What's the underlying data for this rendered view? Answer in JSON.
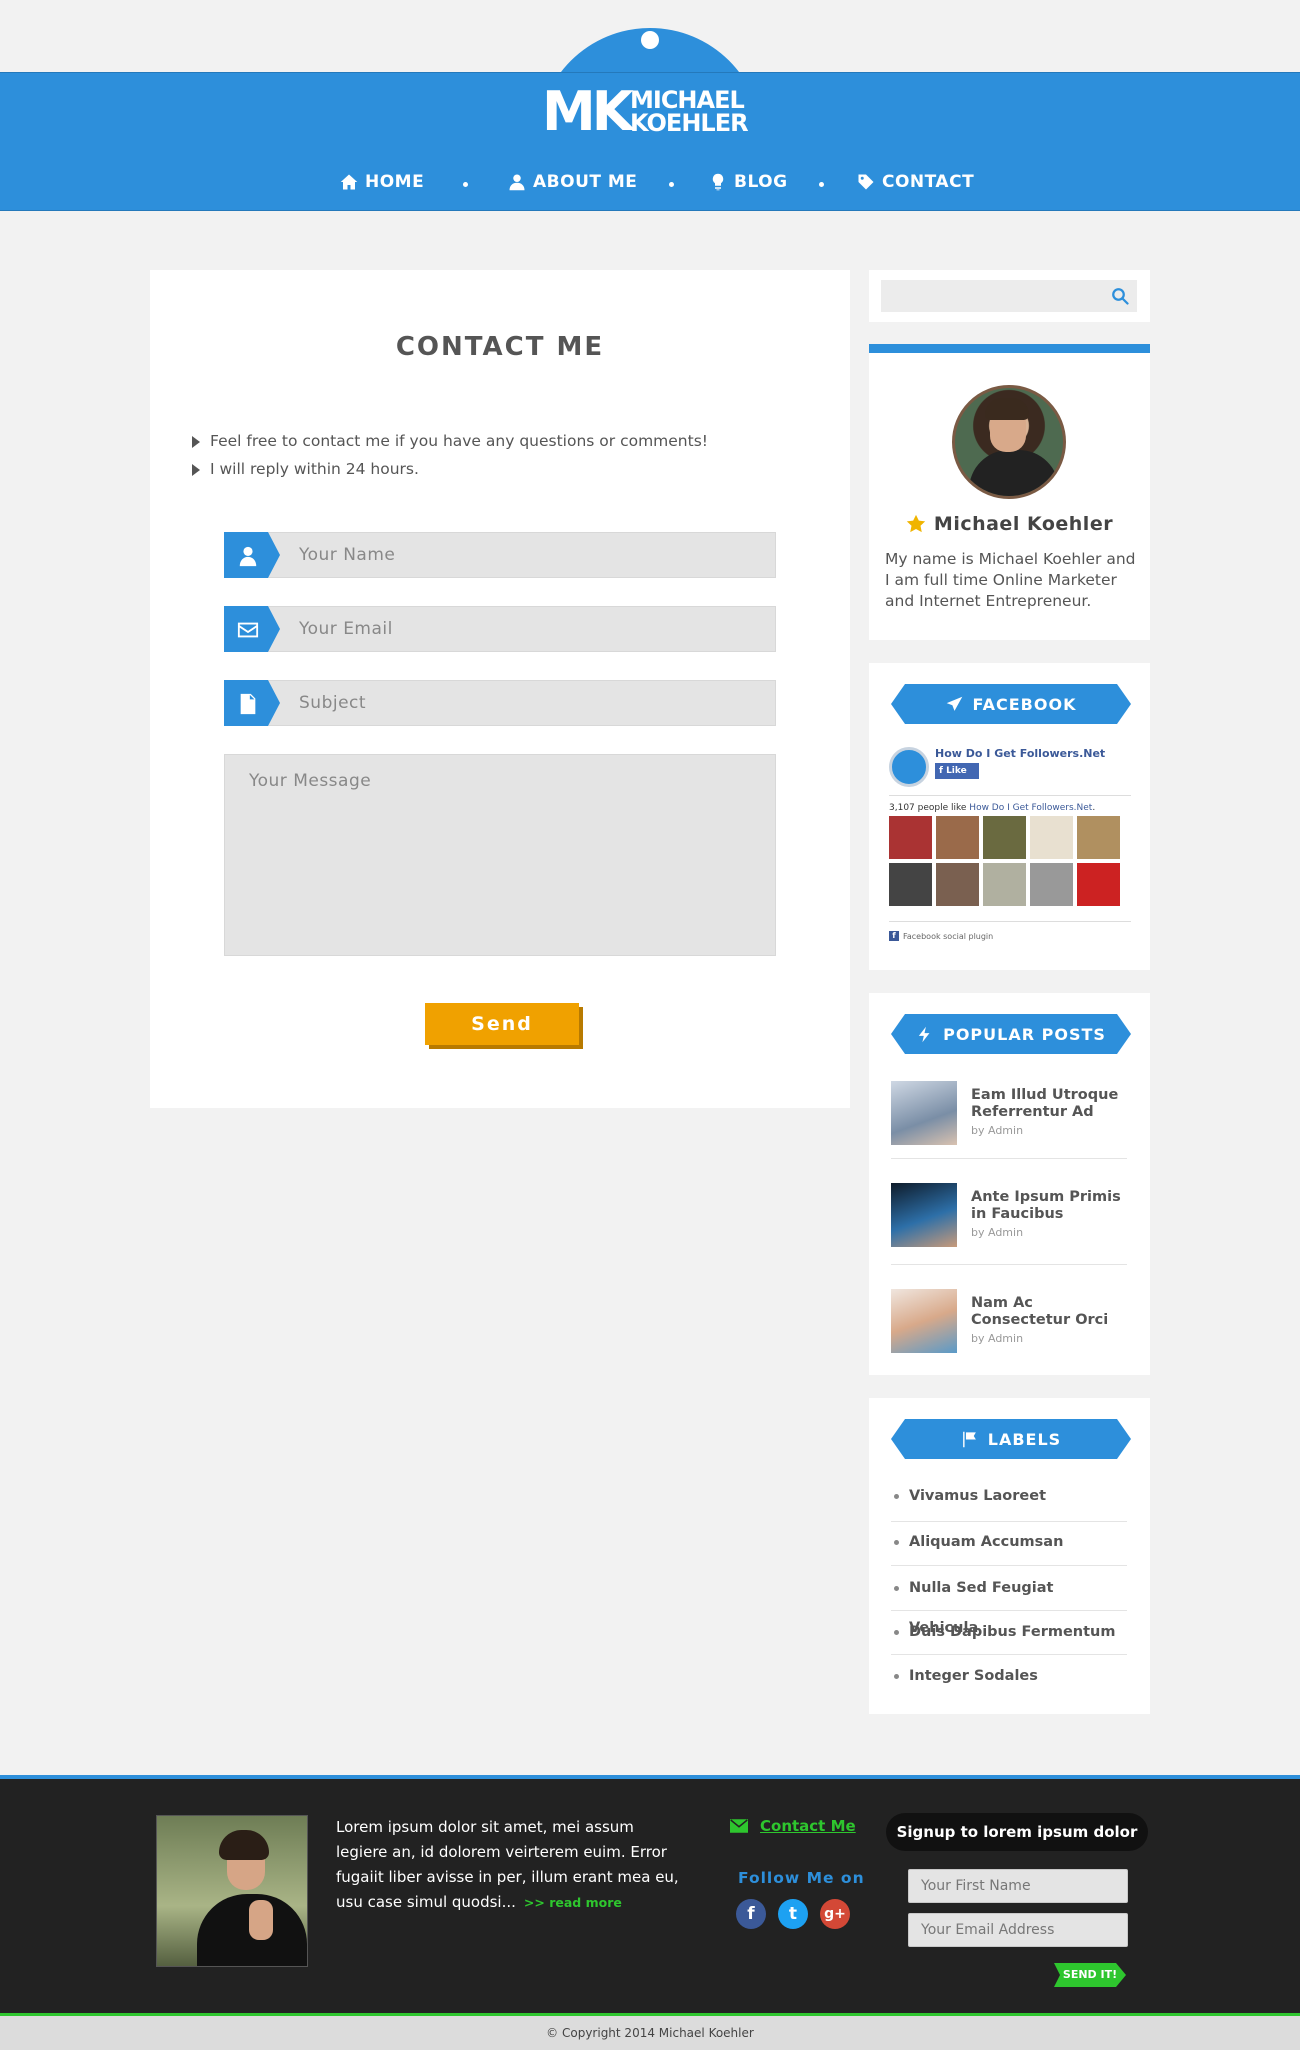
{
  "header": {
    "logo_mk": "MK",
    "logo_first": "MICHAEL",
    "logo_last": "KOEHLER",
    "nav": [
      {
        "label": "HOME",
        "icon": "home-icon"
      },
      {
        "label": "ABOUT ME",
        "icon": "user-icon"
      },
      {
        "label": "BLOG",
        "icon": "lightbulb-icon"
      },
      {
        "label": "CONTACT",
        "icon": "tag-icon"
      }
    ]
  },
  "contact": {
    "title": "CONTACT ME",
    "intro": [
      "Feel free to contact me if you have any questions or comments!",
      "I will reply within 24 hours."
    ],
    "name_placeholder": "Your Name",
    "email_placeholder": "Your Email",
    "subject_placeholder": "Subject",
    "message_placeholder": "Your Message",
    "send_label": "Send"
  },
  "sidebar": {
    "search_placeholder": "",
    "profile": {
      "name": "Michael Koehler",
      "bio": "My name is Michael Koehler and I am full time Online Marketer and Internet Entrepreneur."
    },
    "facebook": {
      "title": "FACEBOOK",
      "page_name": "How Do I Get Followers.Net",
      "like_label": "Like",
      "count_prefix": "3,107 people like ",
      "count_link": "How Do I Get Followers.Net",
      "count_suffix": ".",
      "plugin_label": "Facebook social plugin"
    },
    "popular": {
      "title": "POPULAR POSTS",
      "posts": [
        {
          "title": "Eam Illud Utroque Referrentur Ad",
          "meta": "by Admin"
        },
        {
          "title": "Ante Ipsum Primis in Faucibus",
          "meta": "by Admin"
        },
        {
          "title": "Nam Ac Consectetur Orci",
          "meta": "by Admin"
        }
      ]
    },
    "labels": {
      "title": "LABELS",
      "items": [
        "Vivamus Laoreet",
        "Aliquam Accumsan",
        "Nulla Sed Feugiat Vehicula",
        "Duis Dapibus Fermentum",
        "Integer Sodales"
      ]
    }
  },
  "footer": {
    "about": "Lorem ipsum dolor sit amet, mei assum legiere an, id dolorem veirterem euim. Error fugaiit liber avisse in per, illum erant mea eu, usu case simul quodsi...",
    "read_more": ">> read more",
    "contact_link": "Contact Me",
    "follow_label": "Follow Me on",
    "social": [
      "f",
      "t",
      "g+"
    ],
    "signup_title": "Signup to lorem ipsum dolor",
    "first_name_placeholder": "Your First Name",
    "email_placeholder": "Your Email Address",
    "send_label": "SEND IT!",
    "copyright": "© Copyright 2014 Michael Koehler"
  },
  "colors": {
    "accent": "#2d8fdb",
    "button": "#f0a100",
    "green": "#2ec62e",
    "footer_bg": "#222222"
  }
}
